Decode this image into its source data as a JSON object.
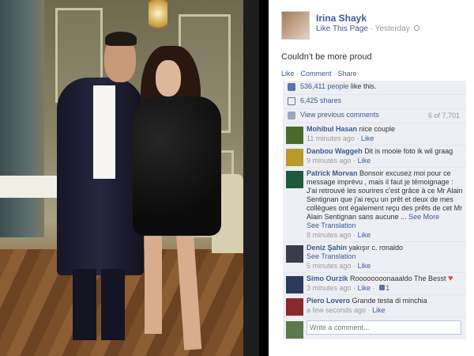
{
  "post": {
    "owner_name": "Irina Shayk",
    "like_page": "Like This Page",
    "separator": "·",
    "time": "Yesterday",
    "caption": "Couldn't be more proud"
  },
  "actions": {
    "like": "Like",
    "comment": "Comment",
    "share": "Share",
    "sep": "·"
  },
  "stats": {
    "likes_count": "536,411 people",
    "likes_suffix": "like this.",
    "shares": "6,425 shares",
    "view_previous": "View previous comments",
    "comment_count": "6 of 7,701"
  },
  "comments": [
    {
      "name": "Mohibul Hasan",
      "text": "nice couple",
      "time": "11 minutes ago",
      "like": "Like",
      "color": "#4a6a2a"
    },
    {
      "name": "Danbou Waggeh",
      "text": "Dit is mooie foto ik wil graag",
      "time": "9 minutes ago",
      "like": "Like",
      "color": "#b99a2a"
    },
    {
      "name": "Patrick Morvan",
      "text": "Bonsoir excusez moi pour ce message imprévu , mais il faut je témoignage : J'ai retrouvé les sourires c'est grâce à ce Mr Alain Sentignan que j'ai reçu un prêt et deux de mes collègues ont également reçu des prêts de cet Mr Alain Sentignan sans aucune ...",
      "see_more": "See More",
      "translation": "See Translation",
      "time": "8 minutes ago",
      "like": "Like",
      "color": "#1e5a3a"
    },
    {
      "name": "Deniz Şahin",
      "text": "yakışır c. ronaldo",
      "translation": "See Translation",
      "time": "5 minutes ago",
      "like": "Like",
      "color": "#3b3b4a"
    },
    {
      "name": "Simo Ourzik",
      "text": "Roooooooonaaaldo The Besst",
      "time": "3 minutes ago",
      "like": "Like",
      "likes": "1",
      "color": "#2a3a5a"
    },
    {
      "name": "Piero Lovero",
      "text": "Grande testa di minchia",
      "time": "a few seconds ago",
      "like": "Like",
      "color": "#8a2a2a"
    }
  ],
  "write_comment": {
    "placeholder": "Write a comment..."
  },
  "colors": {
    "link": "#3b5998",
    "ufi_bg": "#edeff4"
  }
}
